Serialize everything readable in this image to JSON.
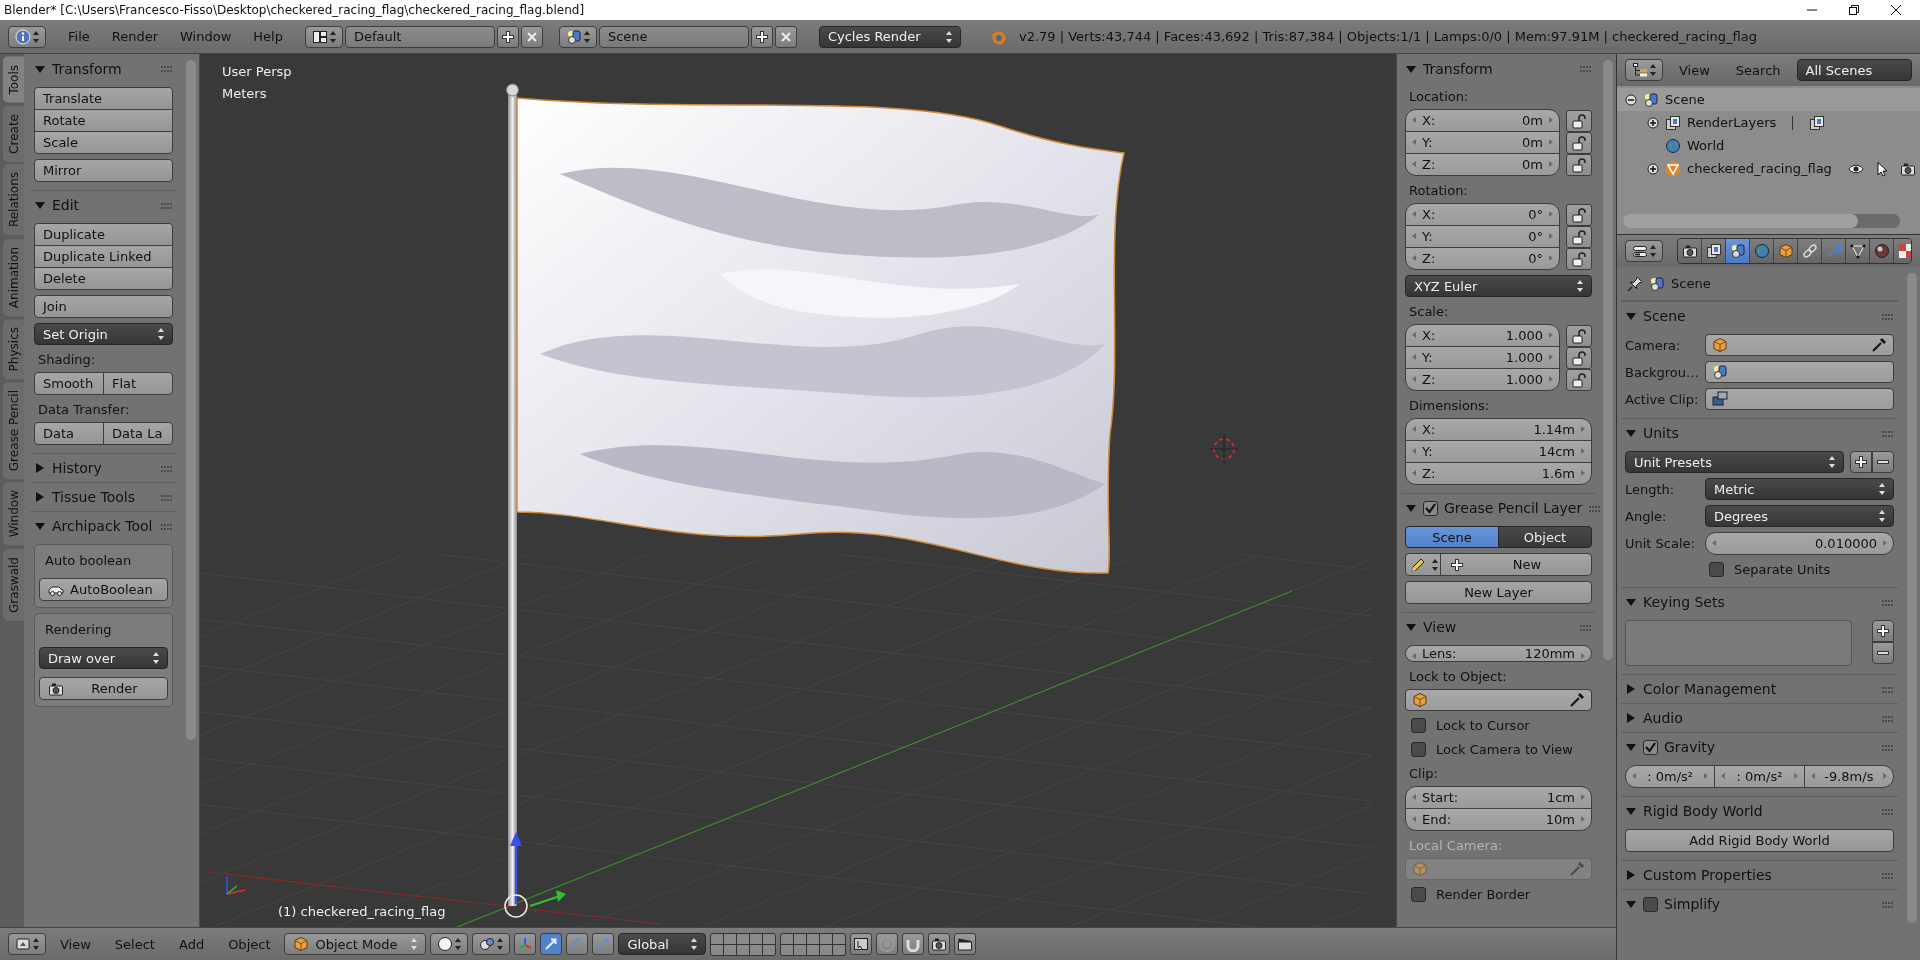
{
  "title_bar": {
    "title": "Blender* [C:\\Users\\Francesco-Fisso\\Desktop\\checkered_racing_flag\\checkered_racing_flag.blend]"
  },
  "info_header": {
    "menus": [
      "File",
      "Render",
      "Window",
      "Help"
    ],
    "layout": "Default",
    "scene": "Scene",
    "engine": "Cycles Render",
    "stats": "v2.79 | Verts:43,744 | Faces:43,692 | Tris:87,384 | Objects:1/1 | Lamps:0/0 | Mem:97.91M | checkered_racing_flag"
  },
  "tool_tabs": [
    {
      "label": "Tools",
      "selected": true
    },
    {
      "label": "Create",
      "selected": false
    },
    {
      "label": "Relations",
      "selected": false
    },
    {
      "label": "Animation",
      "selected": false
    },
    {
      "label": "Physics",
      "selected": false
    },
    {
      "label": "Grease Pencil",
      "selected": false
    },
    {
      "label": "Window",
      "selected": false
    },
    {
      "label": "Graswald",
      "selected": false
    }
  ],
  "tool_shelf": {
    "panels": [
      {
        "title": "Transform",
        "expanded": true,
        "items": [
          {
            "kind": "stack",
            "labels": [
              "Translate",
              "Rotate",
              "Scale"
            ]
          },
          {
            "kind": "button",
            "label": "Mirror"
          }
        ]
      },
      {
        "title": "Edit",
        "expanded": true,
        "items": [
          {
            "kind": "stack",
            "labels": [
              "Duplicate",
              "Duplicate Linked",
              "Delete"
            ]
          },
          {
            "kind": "button",
            "label": "Join"
          },
          {
            "kind": "dropdown",
            "label": "Set Origin"
          },
          {
            "kind": "caption",
            "label": "Shading:"
          },
          {
            "kind": "row",
            "labels": [
              "Smooth",
              "Flat"
            ]
          },
          {
            "kind": "caption",
            "label": "Data Transfer:"
          },
          {
            "kind": "row",
            "labels": [
              "Data",
              "Data La"
            ]
          }
        ]
      },
      {
        "title": "History",
        "expanded": false
      },
      {
        "title": "Tissue Tools",
        "expanded": false
      },
      {
        "title": "Archipack Tool",
        "expanded": true,
        "items": [
          {
            "kind": "box",
            "items": [
              {
                "kind": "label",
                "label": "Auto boolean"
              },
              {
                "kind": "boolean_button",
                "label": "AutoBoolean"
              }
            ]
          },
          {
            "kind": "box",
            "items": [
              {
                "kind": "label",
                "label": "Rendering"
              },
              {
                "kind": "dropdown",
                "label": "Draw over"
              },
              {
                "kind": "render_button",
                "label": "Render"
              }
            ]
          }
        ]
      }
    ]
  },
  "viewport": {
    "view_name": "User Persp",
    "units": "Meters",
    "object_label": "(1) checkered_racing_flag"
  },
  "n_panel": {
    "panels": [
      {
        "title": "Transform",
        "expanded": true,
        "items": [
          {
            "kind": "caption",
            "label": "Location:"
          },
          {
            "kind": "vector",
            "fields": [
              {
                "label": "X:",
                "value": "0m",
                "locked": false
              },
              {
                "label": "Y:",
                "value": "0m",
                "locked": false
              },
              {
                "label": "Z:",
                "value": "0m",
                "locked": false
              }
            ]
          },
          {
            "kind": "caption",
            "label": "Rotation:"
          },
          {
            "kind": "vector",
            "fields": [
              {
                "label": "X:",
                "value": "0°",
                "locked": false
              },
              {
                "label": "Y:",
                "value": "0°",
                "locked": false
              },
              {
                "label": "Z:",
                "value": "0°",
                "locked": false
              }
            ]
          },
          {
            "kind": "dropdown",
            "label": "XYZ Euler"
          },
          {
            "kind": "caption",
            "label": "Scale:"
          },
          {
            "kind": "vector",
            "fields": [
              {
                "label": "X:",
                "value": "1.000",
                "locked": false
              },
              {
                "label": "Y:",
                "value": "1.000",
                "locked": false
              },
              {
                "label": "Z:",
                "value": "1.000",
                "locked": false
              }
            ]
          },
          {
            "kind": "caption",
            "label": "Dimensions:"
          },
          {
            "kind": "vector",
            "fields": [
              {
                "label": "X:",
                "value": "1.14m"
              },
              {
                "label": "Y:",
                "value": "14cm"
              },
              {
                "label": "Z:",
                "value": "1.6m"
              }
            ]
          }
        ]
      },
      {
        "title": "Grease Pencil Layer",
        "expanded": true,
        "checked": true,
        "items": [
          {
            "kind": "toggle",
            "options": [
              {
                "label": "Scene",
                "selected": true
              },
              {
                "label": "Object",
                "selected": false
              }
            ]
          },
          {
            "kind": "new_row",
            "label": "New"
          },
          {
            "kind": "button",
            "label": "New Layer"
          }
        ]
      },
      {
        "title": "View",
        "expanded": true,
        "items": [
          {
            "kind": "field",
            "label": "Lens:",
            "value": "120mm"
          },
          {
            "kind": "caption",
            "label": "Lock to Object:"
          },
          {
            "kind": "object_field"
          },
          {
            "kind": "checkbox",
            "label": "Lock to Cursor",
            "checked": false
          },
          {
            "kind": "checkbox",
            "label": "Lock Camera to View",
            "checked": false
          },
          {
            "kind": "caption",
            "label": "Clip:"
          },
          {
            "kind": "vector",
            "fields": [
              {
                "label": "Start:",
                "value": "1cm"
              },
              {
                "label": "End:",
                "value": "10m"
              }
            ]
          },
          {
            "kind": "caption",
            "label": "Local Camera:",
            "disabled": true
          },
          {
            "kind": "object_field",
            "disabled": true
          },
          {
            "kind": "checkbox",
            "label": "Render Border",
            "checked": false
          }
        ]
      }
    ]
  },
  "outliner": {
    "menus": [
      "View",
      "Search"
    ],
    "filter": "All Scenes",
    "tree": [
      {
        "label": "Scene",
        "kind": "scene",
        "expanded": true,
        "selected": true,
        "children": [
          {
            "label": "RenderLayers",
            "kind": "render_layers",
            "expanded": false,
            "selected": false
          },
          {
            "label": "World",
            "kind": "world",
            "selected": false
          },
          {
            "label": "checkered_racing_flag",
            "kind": "mesh_object",
            "expanded": false,
            "selected": false
          }
        ]
      }
    ]
  },
  "properties": {
    "context_tabs": [
      {
        "selected": false
      },
      {
        "selected": false
      },
      {
        "selected": true
      },
      {
        "selected": false
      },
      {
        "selected": false
      },
      {
        "selected": false
      },
      {
        "selected": false
      },
      {
        "selected": false
      },
      {
        "selected": false
      },
      {
        "selected": false
      }
    ],
    "breadcrumb": "Scene",
    "panels": [
      {
        "title": "Scene",
        "expanded": true,
        "items": [
          {
            "kind": "camera_field",
            "label": "Camera:"
          },
          {
            "kind": "scene_field",
            "label": "Backgrou…"
          },
          {
            "kind": "clip_field",
            "label": "Active Clip:"
          }
        ]
      },
      {
        "title": "Units",
        "expanded": true,
        "items": [
          {
            "kind": "preset_row",
            "label": "Unit Presets"
          },
          {
            "kind": "dropdown_row",
            "label": "Length:",
            "value": "Metric"
          },
          {
            "kind": "dropdown_row",
            "label": "Angle:",
            "value": "Degrees"
          },
          {
            "kind": "number_row",
            "label": "Unit Scale:",
            "value": "0.010000"
          },
          {
            "kind": "checkbox",
            "label": "Separate Units",
            "checked": false
          }
        ]
      },
      {
        "title": "Keying Sets",
        "expanded": true,
        "items": [
          {
            "kind": "list"
          }
        ]
      },
      {
        "title": "Color Management",
        "expanded": false
      },
      {
        "title": "Audio",
        "expanded": false
      },
      {
        "title": "Gravity",
        "expanded": true,
        "checked": true,
        "items": [
          {
            "kind": "vector_row",
            "values": [
              ": 0m/s²",
              ": 0m/s²",
              "-9.8m/s"
            ]
          }
        ]
      },
      {
        "title": "Rigid Body World",
        "expanded": true,
        "items": [
          {
            "kind": "button",
            "label": "Add Rigid Body World"
          }
        ]
      },
      {
        "title": "Custom Properties",
        "expanded": false
      },
      {
        "title": "Simplify",
        "expanded": true,
        "checked": false
      }
    ]
  },
  "view3d_header": {
    "menus": [
      "View",
      "Select",
      "Add",
      "Object"
    ],
    "mode": "Object Mode",
    "orientation": "Global"
  }
}
